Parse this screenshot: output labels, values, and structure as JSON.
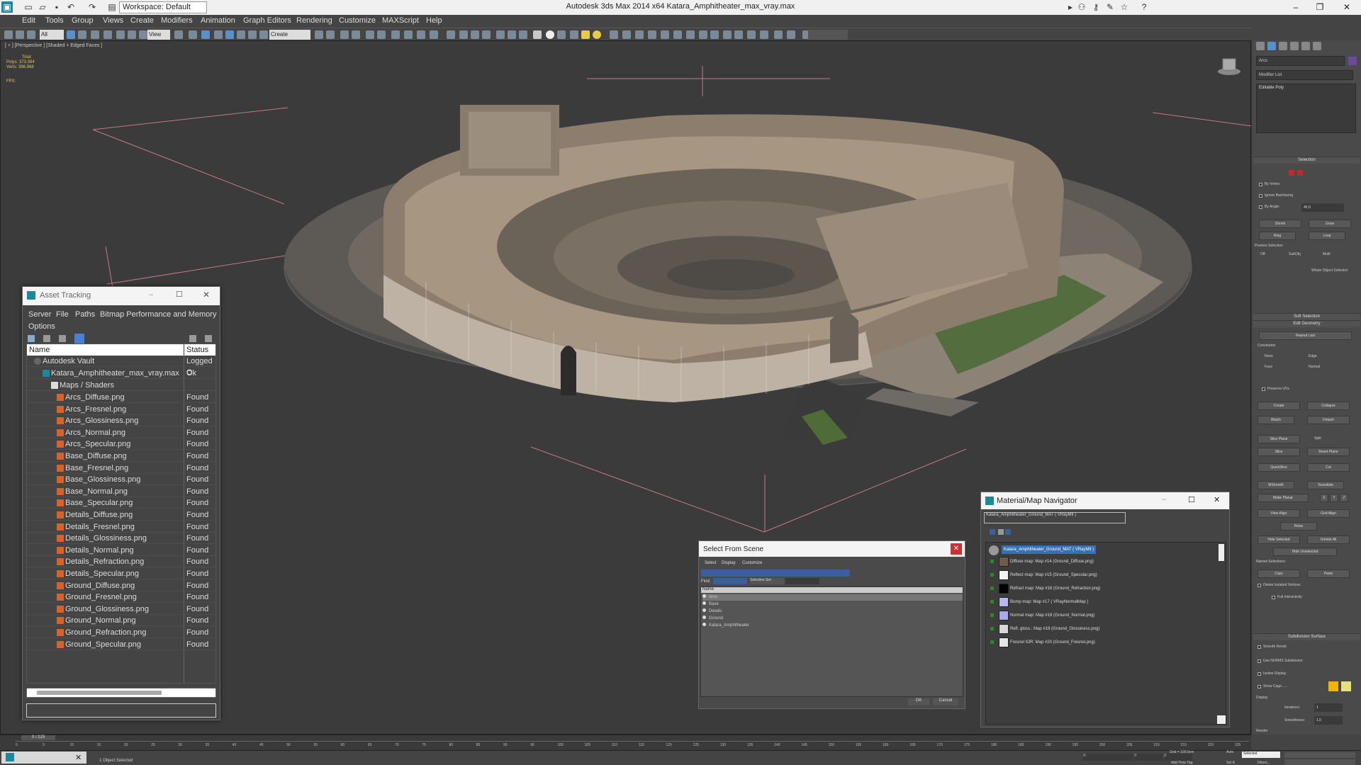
{
  "app": {
    "title": "Autodesk 3ds Max  2014 x64     Katara_Amphitheater_max_vray.max",
    "workspace": "Workspace: Default"
  },
  "menu": [
    "Edit",
    "Tools",
    "Group",
    "Views",
    "Create",
    "Modifiers",
    "Animation",
    "Graph Editors",
    "Rendering",
    "Customize",
    "MAXScript",
    "Help"
  ],
  "toolbar": {
    "filter": "All",
    "view": "View",
    "selection_set": "Create Selection Se"
  },
  "viewport": {
    "label": "[ + ] [Perspective ] [Shaded + Edged Faces ]",
    "stats": {
      "total_label": "Total",
      "polys": "Polys:  373.394",
      "verts": "Verts:  386.968"
    },
    "fps": "FPS:"
  },
  "command_panel": {
    "object_name": "Arcs",
    "modifier_list": "Modifier List",
    "stack_item": "Editable Poly",
    "sections": {
      "selection": "Selection",
      "soft_selection": "Soft Selection",
      "edit_geometry": "Edit Geometry",
      "subdivision_surface": "Subdivision Surface"
    },
    "selection": {
      "by_vertex": "By Vertex",
      "ignore_backfacing": "Ignore Backfacing",
      "by_angle": "By Angle:",
      "angle_value": "45.0",
      "shrink": "Shrink",
      "grow": "Grow",
      "ring": "Ring",
      "loop": "Loop",
      "preview_selection": "Preview Selection",
      "off": "Off",
      "subobj": "SubObj",
      "multi": "Multi",
      "whole_object": "Whole Object Selected"
    },
    "edit_geometry": {
      "repeat_last": "Repeat Last",
      "constraints": "Constraints",
      "none": "None",
      "edge": "Edge",
      "face": "Face",
      "normal": "Normal",
      "preserve_uvs": "Preserve UVs",
      "create": "Create",
      "collapse": "Collapse",
      "attach": "Attach",
      "detach": "Detach",
      "slice_plane": "Slice Plane",
      "split": "Split",
      "slice": "Slice",
      "reset_plane": "Reset Plane",
      "quickslice": "QuickSlice",
      "cut": "Cut",
      "msmooth": "MSmooth",
      "tessellate": "Tessellate",
      "make_planar": "Make Planar",
      "x": "X",
      "y": "Y",
      "z": "Z",
      "view_align": "View Align",
      "grid_align": "Grid Align",
      "relax": "Relax",
      "hide_selected": "Hide Selected",
      "unhide_all": "Unhide All",
      "hide_unselected": "Hide Unselected",
      "named_selections": "Named Selections:",
      "copy": "Copy",
      "paste": "Paste",
      "delete_isolated": "Delete Isolated Vertices",
      "full_interactivity": "Full Interactivity"
    },
    "subdivision": {
      "smooth_result": "Smooth Result",
      "use_nurms": "Use NURMS Subdivision",
      "isoline": "Isoline Display",
      "show_cage": "Show Cage......",
      "display": "Display",
      "iterations": "Iterations:",
      "iterations_val": "1",
      "smoothness": "Smoothness:",
      "smoothness_val": "1,0",
      "render": "Render",
      "cage_color_1": "#f2b400",
      "cage_color_2": "#e8e07a"
    }
  },
  "asset_tracking": {
    "title": "Asset Tracking",
    "menu": [
      "Server",
      "File",
      "Paths",
      "Bitmap Performance and Memory",
      "Options"
    ],
    "columns": {
      "name": "Name",
      "status": "Status"
    },
    "vault": {
      "name": "Autodesk Vault",
      "status": "Logged O"
    },
    "file": {
      "name": "Katara_Amphitheater_max_vray.max",
      "status": "Ok"
    },
    "group": "Maps / Shaders",
    "maps": [
      {
        "name": "Arcs_Diffuse.png",
        "status": "Found"
      },
      {
        "name": "Arcs_Fresnel.png",
        "status": "Found"
      },
      {
        "name": "Arcs_Glossiness.png",
        "status": "Found"
      },
      {
        "name": "Arcs_Normal.png",
        "status": "Found"
      },
      {
        "name": "Arcs_Specular.png",
        "status": "Found"
      },
      {
        "name": "Base_Diffuse.png",
        "status": "Found"
      },
      {
        "name": "Base_Fresnel.png",
        "status": "Found"
      },
      {
        "name": "Base_Glossiness.png",
        "status": "Found"
      },
      {
        "name": "Base_Normal.png",
        "status": "Found"
      },
      {
        "name": "Base_Specular.png",
        "status": "Found"
      },
      {
        "name": "Details_Diffuse.png",
        "status": "Found"
      },
      {
        "name": "Details_Fresnel.png",
        "status": "Found"
      },
      {
        "name": "Details_Glossiness.png",
        "status": "Found"
      },
      {
        "name": "Details_Normal.png",
        "status": "Found"
      },
      {
        "name": "Details_Refraction.png",
        "status": "Found"
      },
      {
        "name": "Details_Specular.png",
        "status": "Found"
      },
      {
        "name": "Ground_Diffuse.png",
        "status": "Found"
      },
      {
        "name": "Ground_Fresnel.png",
        "status": "Found"
      },
      {
        "name": "Ground_Glossiness.png",
        "status": "Found"
      },
      {
        "name": "Ground_Normal.png",
        "status": "Found"
      },
      {
        "name": "Ground_Refraction.png",
        "status": "Found"
      },
      {
        "name": "Ground_Specular.png",
        "status": "Found"
      }
    ]
  },
  "select_from_scene": {
    "title": "Select From Scene",
    "menu": [
      "Select",
      "Display",
      "Customize"
    ],
    "find_label": "Find:",
    "selection_set_label": "Selection Set:",
    "column_name": "Name",
    "items": [
      "Arcs",
      "Base",
      "Details",
      "Ground",
      "Katara_Amphitheater"
    ],
    "ok": "OK",
    "cancel": "Cancel"
  },
  "material_navigator": {
    "title": "Material/Map Navigator",
    "current": "Katara_Amphitheater_Ground_MAT  ( VRayMtl )",
    "root": "Katara_Amphitheater_Ground_MAT  ( VRayMtl )",
    "items": [
      {
        "label": "Diffuse map: Map #14 (Ground_Diffuse.png)",
        "color": "#6d5c4e"
      },
      {
        "label": "Reflect map: Map #15 (Ground_Specular.png)",
        "color": "#f4f4f4"
      },
      {
        "label": "Refract map: Map #16 (Ground_Refraction.png)",
        "color": "#000000"
      },
      {
        "label": "Bump map: Map #17  ( VRayNormalMap )",
        "color": "#b8b8f0"
      },
      {
        "label": "Normal map: Map #18 (Ground_Normal.png)",
        "color": "#a9a9ee"
      },
      {
        "label": "Refl. gloss.: Map #19 (Ground_Glossiness.png)",
        "color": "#d8d8d8"
      },
      {
        "label": "Fresnel IOR: Map #20 (Ground_Fresnel.png)",
        "color": "#e6e6e6"
      }
    ]
  },
  "timeline": {
    "frame": "0 / 225",
    "ticks": [
      "0",
      "5",
      "10",
      "15",
      "20",
      "25",
      "30",
      "35",
      "40",
      "45",
      "50",
      "55",
      "60",
      "65",
      "70",
      "75",
      "80",
      "85",
      "90",
      "95",
      "100",
      "105",
      "110",
      "115",
      "120",
      "125",
      "130",
      "135",
      "140",
      "145",
      "150",
      "155",
      "160",
      "165",
      "170",
      "175",
      "180",
      "185",
      "190",
      "195",
      "200",
      "205",
      "210",
      "215",
      "220",
      "225"
    ]
  },
  "status": {
    "objects": "1 Object Selected",
    "grid": "Grid = 100,0cm",
    "auto": "Auto",
    "selected": "Selected",
    "set_key": "Set K.",
    "filters": "Filters...",
    "add_time_tag": "Add Time Tag",
    "x": "X:",
    "y": "Y:",
    "z": "Z:"
  }
}
